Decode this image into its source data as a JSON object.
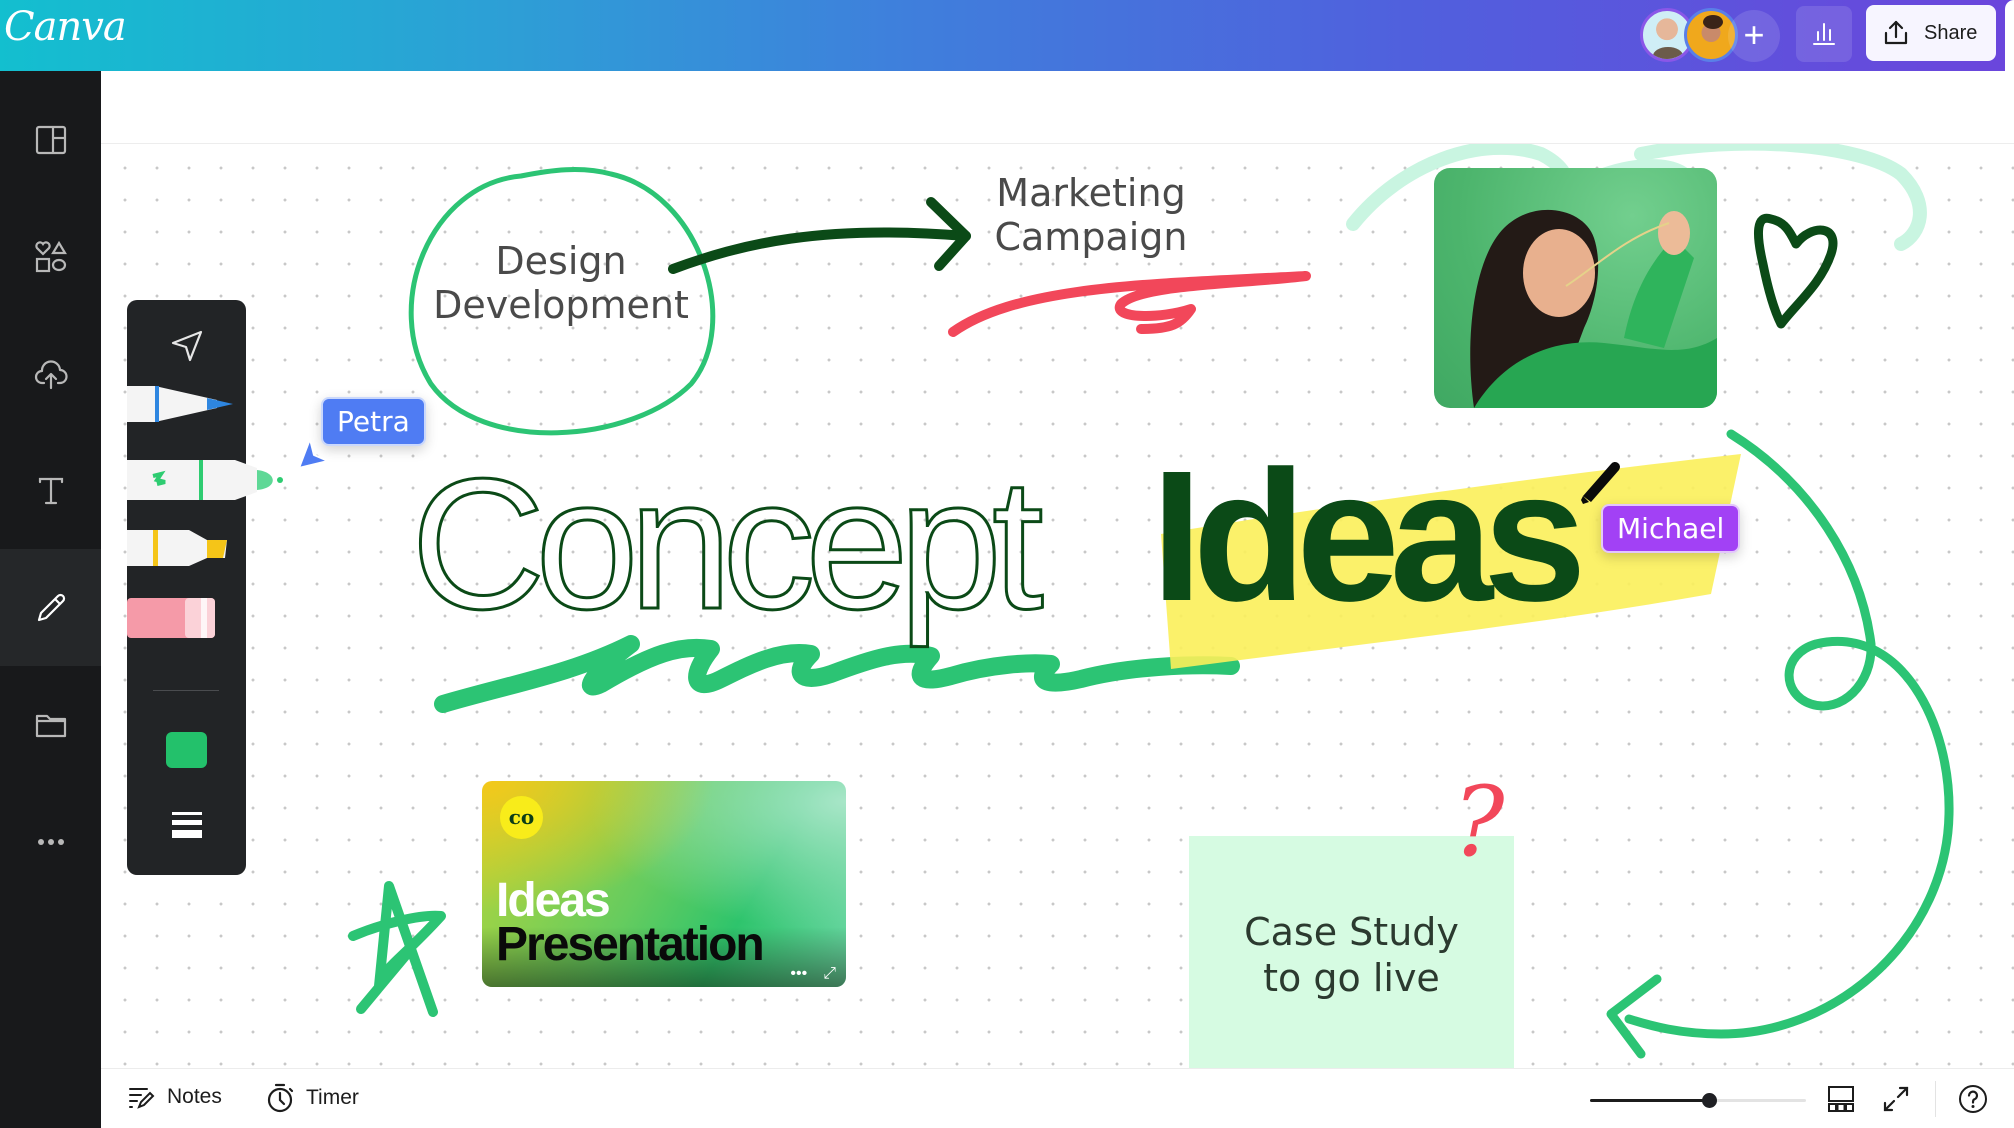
{
  "app": {
    "logo": "Canva"
  },
  "topbar": {
    "collaborators": [
      {
        "name": "collaborator-1",
        "color": "#8a57e8"
      },
      {
        "name": "collaborator-2",
        "color": "#5a7fe8"
      }
    ],
    "add_collaborator_icon": "+",
    "analytics_icon": "bar-chart-icon",
    "share_label": "Share",
    "gradient_colors": [
      "#13bfcf",
      "#3f7fdc",
      "#6b45dc"
    ]
  },
  "sidebar": {
    "items": [
      {
        "id": "design",
        "icon": "layout-icon"
      },
      {
        "id": "elements",
        "icon": "shapes-icon"
      },
      {
        "id": "uploads",
        "icon": "cloud-upload-icon"
      },
      {
        "id": "text",
        "icon": "text-icon"
      },
      {
        "id": "draw",
        "icon": "pencil-icon",
        "active": true
      },
      {
        "id": "projects",
        "icon": "folder-icon"
      },
      {
        "id": "more",
        "icon": "more-icon"
      }
    ]
  },
  "draw_toolbar": {
    "tools": [
      {
        "id": "select",
        "icon": "cursor-icon"
      },
      {
        "id": "pen",
        "color": "#2e86e0"
      },
      {
        "id": "marker",
        "color": "#2ecc71",
        "active": true
      },
      {
        "id": "highlighter",
        "color": "#f5c518"
      },
      {
        "id": "eraser",
        "color": "#f59aa8"
      }
    ],
    "current_color": "#23c16b",
    "weight_icon": "stroke-weight-icon"
  },
  "cursors": [
    {
      "name": "Petra",
      "color": "#4f7cf3"
    },
    {
      "name": "Michael",
      "color": "#a241f5"
    }
  ],
  "canvas": {
    "design_development": [
      "Design",
      "Development"
    ],
    "marketing_campaign": [
      "Marketing",
      "Campaign"
    ],
    "headline_outline": "Concept",
    "headline_bold": "Ideas",
    "presentation": {
      "logo": "co",
      "title_1": "Ideas",
      "title_2": "Presentation",
      "more": "•••",
      "expand": "⤢"
    },
    "sticky_note": [
      "Case Study",
      "to go live"
    ],
    "question_mark": "?",
    "colors": {
      "green": "#2cc474",
      "dark_green": "#0b4a17",
      "red": "#f2475a",
      "yellow": "#fbef5a",
      "sticky_bg": "#d6fbe2"
    }
  },
  "bottombar": {
    "notes_label": "Notes",
    "timer_label": "Timer",
    "zoom_percent": 55,
    "page_view_icon": "grid-view-icon",
    "fullscreen_icon": "fullscreen-icon",
    "help_icon": "help-icon"
  }
}
